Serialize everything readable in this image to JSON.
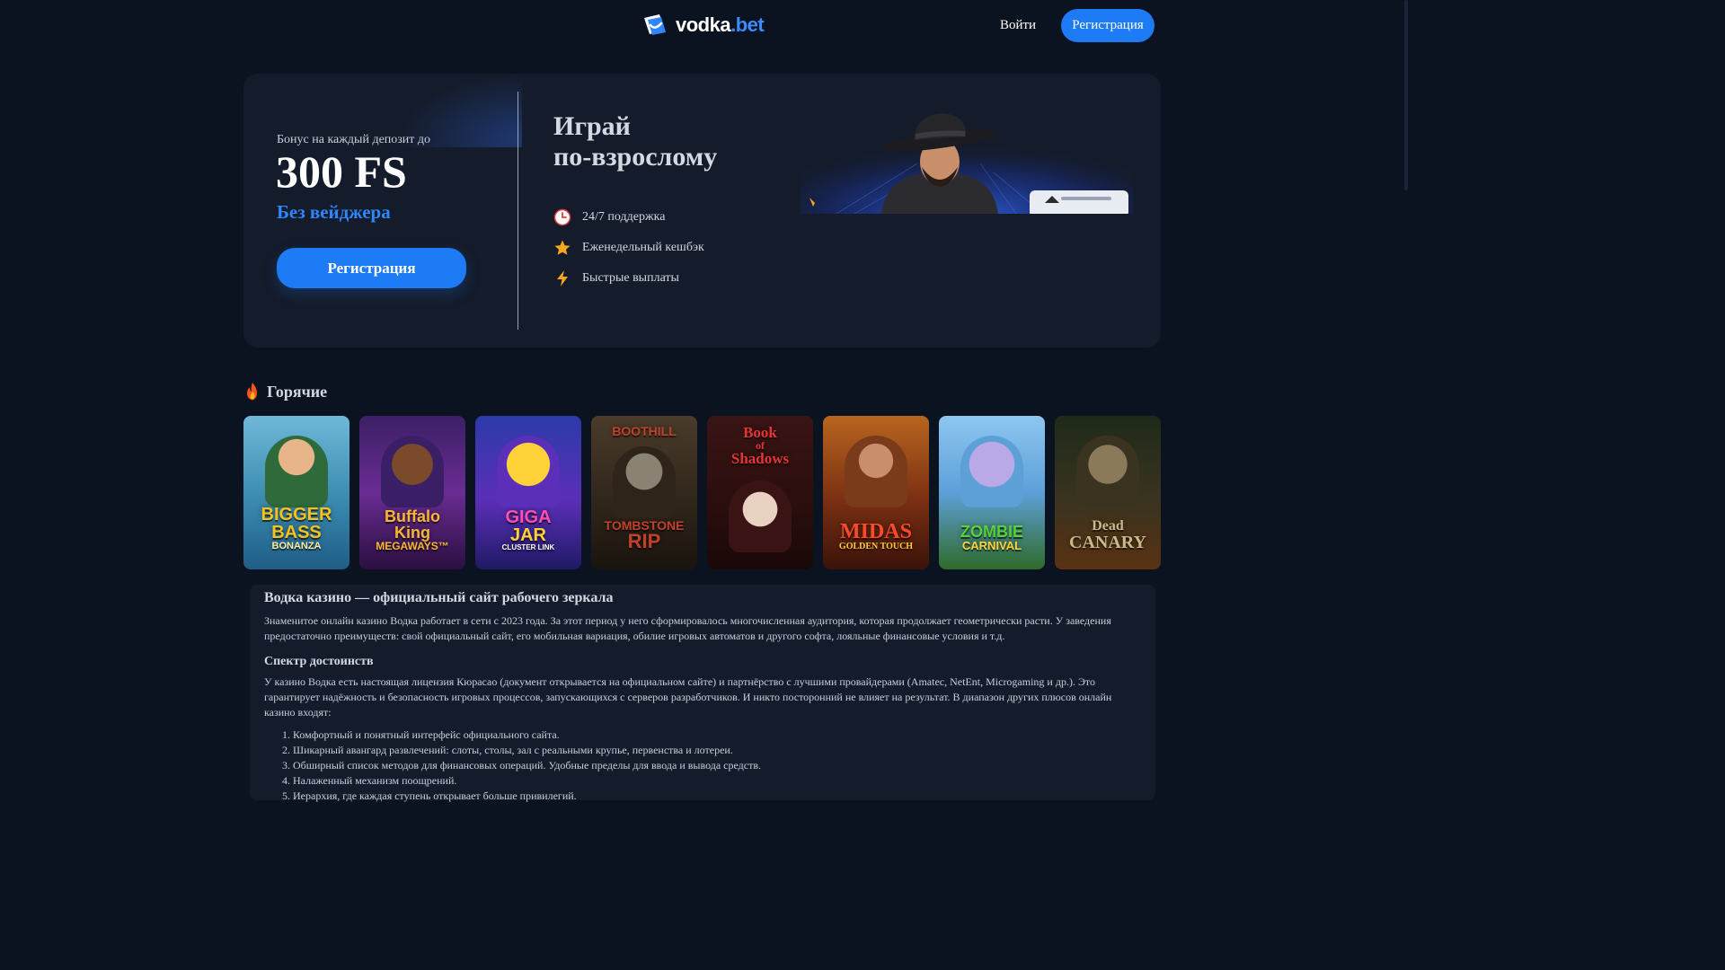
{
  "header": {
    "logo_name": "vodka",
    "logo_tld": ".bet",
    "login_label": "Войти",
    "register_label": "Регистрация"
  },
  "hero": {
    "bonus_label": "Бонус на каждый депозит до",
    "bonus_amount": "300 FS",
    "bonus_sub": "Без вейджера",
    "register_label": "Регистрация",
    "slogan_line1": "Играй",
    "slogan_line2": "по-взрослому",
    "features": [
      {
        "icon": "clock-icon",
        "label": "24/7 поддержка"
      },
      {
        "icon": "star-icon",
        "label": "Еженедельный кешбэк"
      },
      {
        "icon": "lightning-icon",
        "label": "Быстрые выплаты"
      }
    ]
  },
  "hot": {
    "title": "Горячие",
    "icon": "fire-icon",
    "games": [
      {
        "name": "Bigger Bass Bonanza",
        "line1": "BIGGER",
        "line2": "BASS",
        "line3": "BONANZA",
        "color": "#f5c31b"
      },
      {
        "name": "Buffalo King Megaways",
        "line1": "Buffalo",
        "line2": "King",
        "line3": "MEGAWAYS™",
        "color": "#f7b733"
      },
      {
        "name": "Giga Jar",
        "line1": "GIGA",
        "line2": "JAR",
        "line3": "CLUSTER LINK",
        "color": "#ff4fb3"
      },
      {
        "name": "Boothill",
        "line1": "BOOTHILL",
        "line2": "TOMBSTONE",
        "line3": "RIP",
        "color": "#c0412a"
      },
      {
        "name": "Book of Shadows",
        "line1": "Book",
        "line2": "of",
        "line3": "Shadows",
        "color": "#e23636"
      },
      {
        "name": "Midas Golden Touch",
        "line1": "MIDAS",
        "line2": "GOLDEN TOUCH",
        "line3": "",
        "color": "#ffcc33"
      },
      {
        "name": "Zombie Carnival",
        "line1": "ZOMBIE",
        "line2": "CARNIVAL",
        "line3": "",
        "color": "#57d13a"
      },
      {
        "name": "Dead Canary",
        "line1": "Dead",
        "line2": "CANARY",
        "line3": "",
        "color": "#c9b98a"
      }
    ]
  },
  "seo": {
    "title": "Водка казино — официальный сайт рабочего зеркала",
    "intro": "Знаменитое онлайн казино Водка работает в сети с 2023 года. За этот период у него сформировалось многочисленная аудитория, которая продолжает геометрически расти. У заведения предостаточно преимуществ: свой официальный сайт, его мобильная вариация, обилие игровых автоматов и другого софта, лояльные финансовые условия и т.д.",
    "subtitle": "Спектр достоинств",
    "para2": "У казино Водка есть настоящая лицензия Кюрасао (документ открывается на официальном сайте) и партнёрство с лучшими провайдерами (Amatec, NetEnt, Microgaming и др.). Это гарантирует надёжность и безопасность игровых процессов, запускающихся с серверов разработчиков. И никто посторонний не влияет на результат. В диапазон других плюсов онлайн казино входят:",
    "list": [
      "Комфортный и понятный интерфейс официального сайта.",
      "Шикарный авангард развлечений: слоты, столы, зал с реальными крупье, первенства и лотереи.",
      "Обширный список методов для финансовых операций. Удобные пределы для ввода и вывода средств.",
      "Налаженный механизм поощрений.",
      "Иерархия, где каждая ступень открывает больше привилегий."
    ]
  }
}
